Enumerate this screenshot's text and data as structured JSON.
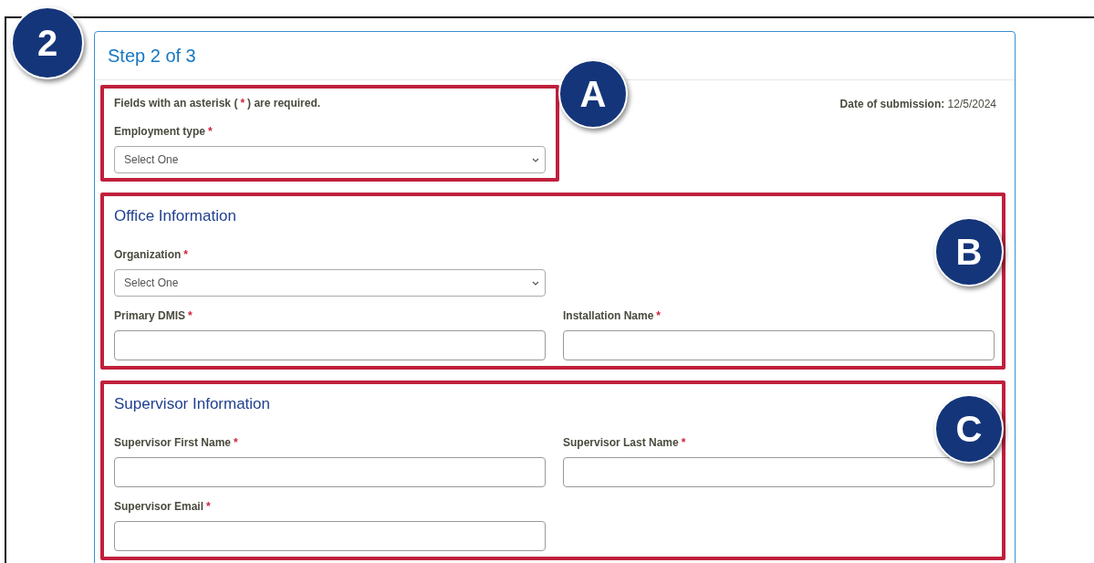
{
  "step_badge": "2",
  "header": {
    "title": "Step 2 of 3"
  },
  "intro": {
    "note_before": "Fields with an asterisk (",
    "note_mark": "*",
    "note_after": ") are required.",
    "date_label": "Date of submission:",
    "date_value": "12/5/2024"
  },
  "sections": [
    {
      "badge": "A",
      "rows": [
        [
          {
            "label": "Employment type",
            "required_mark": "*",
            "kind": "select",
            "value": "Select One"
          }
        ]
      ]
    },
    {
      "badge": "B",
      "title": "Office Information",
      "rows": [
        [
          {
            "label": "Organization",
            "required_mark": "*",
            "kind": "select",
            "value": "Select One"
          }
        ],
        [
          {
            "label": "Primary DMIS",
            "required_mark": "*",
            "kind": "text"
          },
          {
            "label": "Installation Name",
            "required_mark": "*",
            "kind": "text"
          }
        ]
      ]
    },
    {
      "badge": "C",
      "title": "Supervisor Information",
      "rows": [
        [
          {
            "label": "Supervisor First Name",
            "required_mark": "*",
            "kind": "text"
          },
          {
            "label": "Supervisor Last Name",
            "required_mark": "*",
            "kind": "text"
          }
        ],
        [
          {
            "label": "Supervisor Email",
            "required_mark": "*",
            "kind": "text"
          }
        ]
      ]
    }
  ]
}
